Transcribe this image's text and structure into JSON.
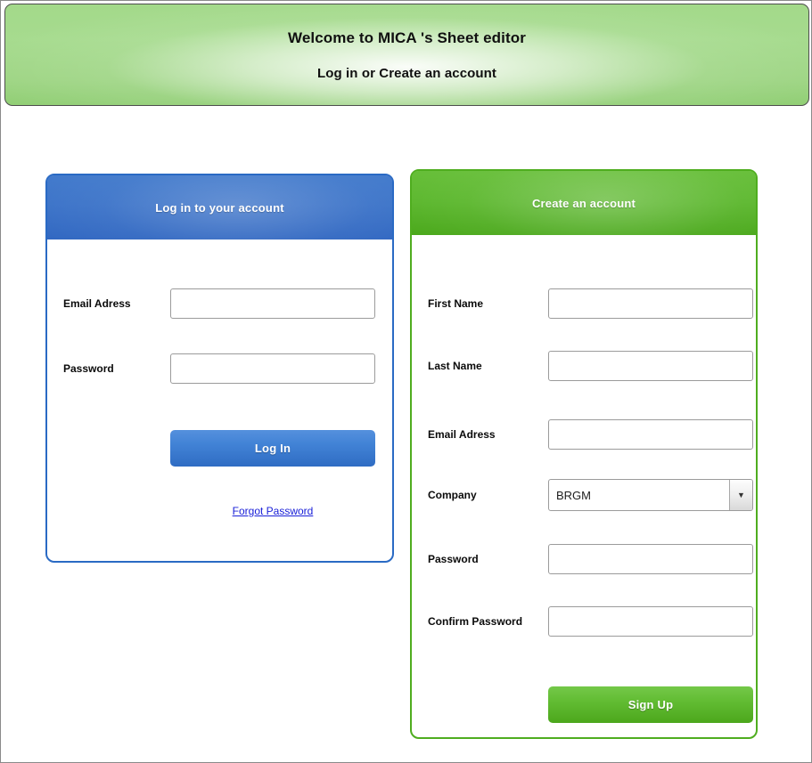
{
  "header": {
    "title": "Welcome to MICA 's Sheet editor",
    "subtitle": "Log in or Create an account"
  },
  "login_panel": {
    "heading": "Log in to your account",
    "email_label": "Email Adress",
    "email_value": "",
    "email_placeholder": "",
    "password_label": "Password",
    "password_value": "",
    "password_placeholder": "",
    "login_button": "Log In",
    "forgot_link": "Forgot Password "
  },
  "signup_panel": {
    "heading": "Create an account",
    "first_name_label": "First Name",
    "first_name_value": "",
    "last_name_label": "Last Name",
    "last_name_value": "",
    "email_label": "Email Adress",
    "email_value": "",
    "company_label": "Company",
    "company_value": "BRGM",
    "company_arrow": "▼",
    "password_label": "Password",
    "password_value": "",
    "confirm_password_label": "Confirm Password",
    "confirm_password_value": "",
    "signup_button": "Sign Up"
  },
  "colors": {
    "banner_green": "#a3d98a",
    "login_blue": "#3a72c8",
    "signup_green": "#59b62a",
    "link_blue": "#1a20d8",
    "input_border": "#9b9b9b"
  }
}
